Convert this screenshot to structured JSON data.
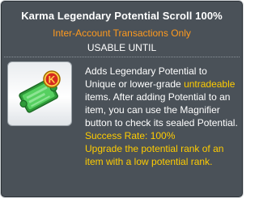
{
  "tooltip": {
    "title": "Karma Legendary Potential Scroll 100%",
    "restriction": "Inter-Account Transactions Only",
    "usable": "USABLE UNTIL",
    "description": {
      "part1": "Adds Legendary Potential to Unique or lower-grade ",
      "highlight": "untradeable",
      "part2": " items. After adding Potential to an item, you can use the Magnifier button to check its sealed Potential."
    },
    "success_rate": "Success Rate: 100%",
    "upgrade_text": "Upgrade the potential rank of an item with a low potential rank.",
    "icon_badge": "K",
    "colors": {
      "background": "#4a5158",
      "restriction": "#ff9a1e",
      "highlight": "#ffcc00",
      "scroll_green": "#3fbf4a",
      "badge_red": "#d62a1f"
    },
    "icon": "karma-legendary-potential-scroll-icon"
  }
}
